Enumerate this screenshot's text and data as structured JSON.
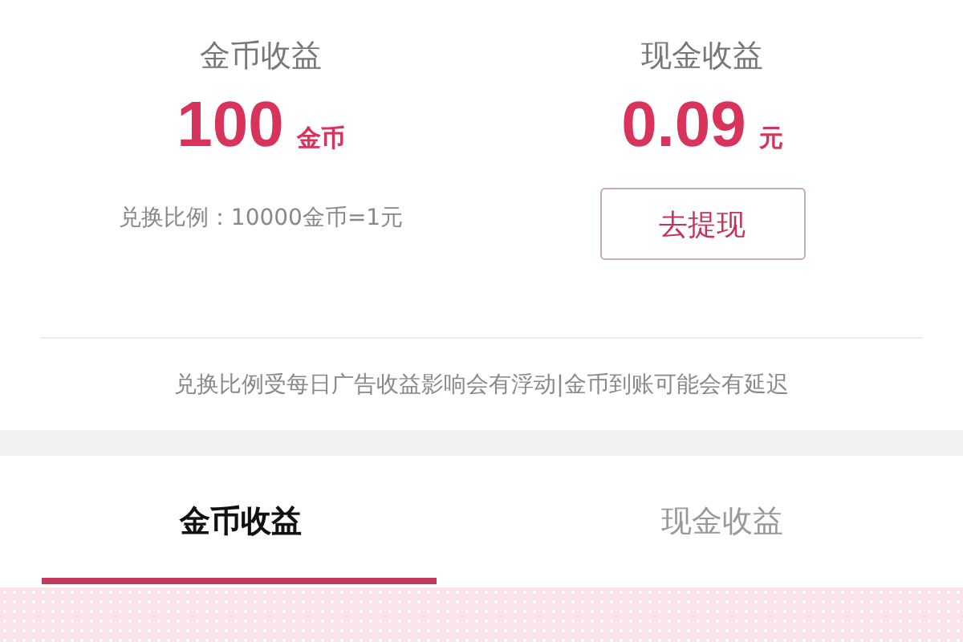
{
  "summary": [
    {
      "title": "金币收益",
      "amount": "100",
      "unit": "金币",
      "kind": "note",
      "note": "兑换比例：10000金币=1元"
    },
    {
      "title": "现金收益",
      "amount": "0.09",
      "unit": "元",
      "kind": "button",
      "button": "去提现"
    }
  ],
  "notice": "兑换比例受每日广告收益影响会有浮动|金币到账可能会有延迟",
  "tabs": [
    {
      "label": "金币收益",
      "selected": true
    },
    {
      "label": "现金收益",
      "selected": false
    }
  ]
}
